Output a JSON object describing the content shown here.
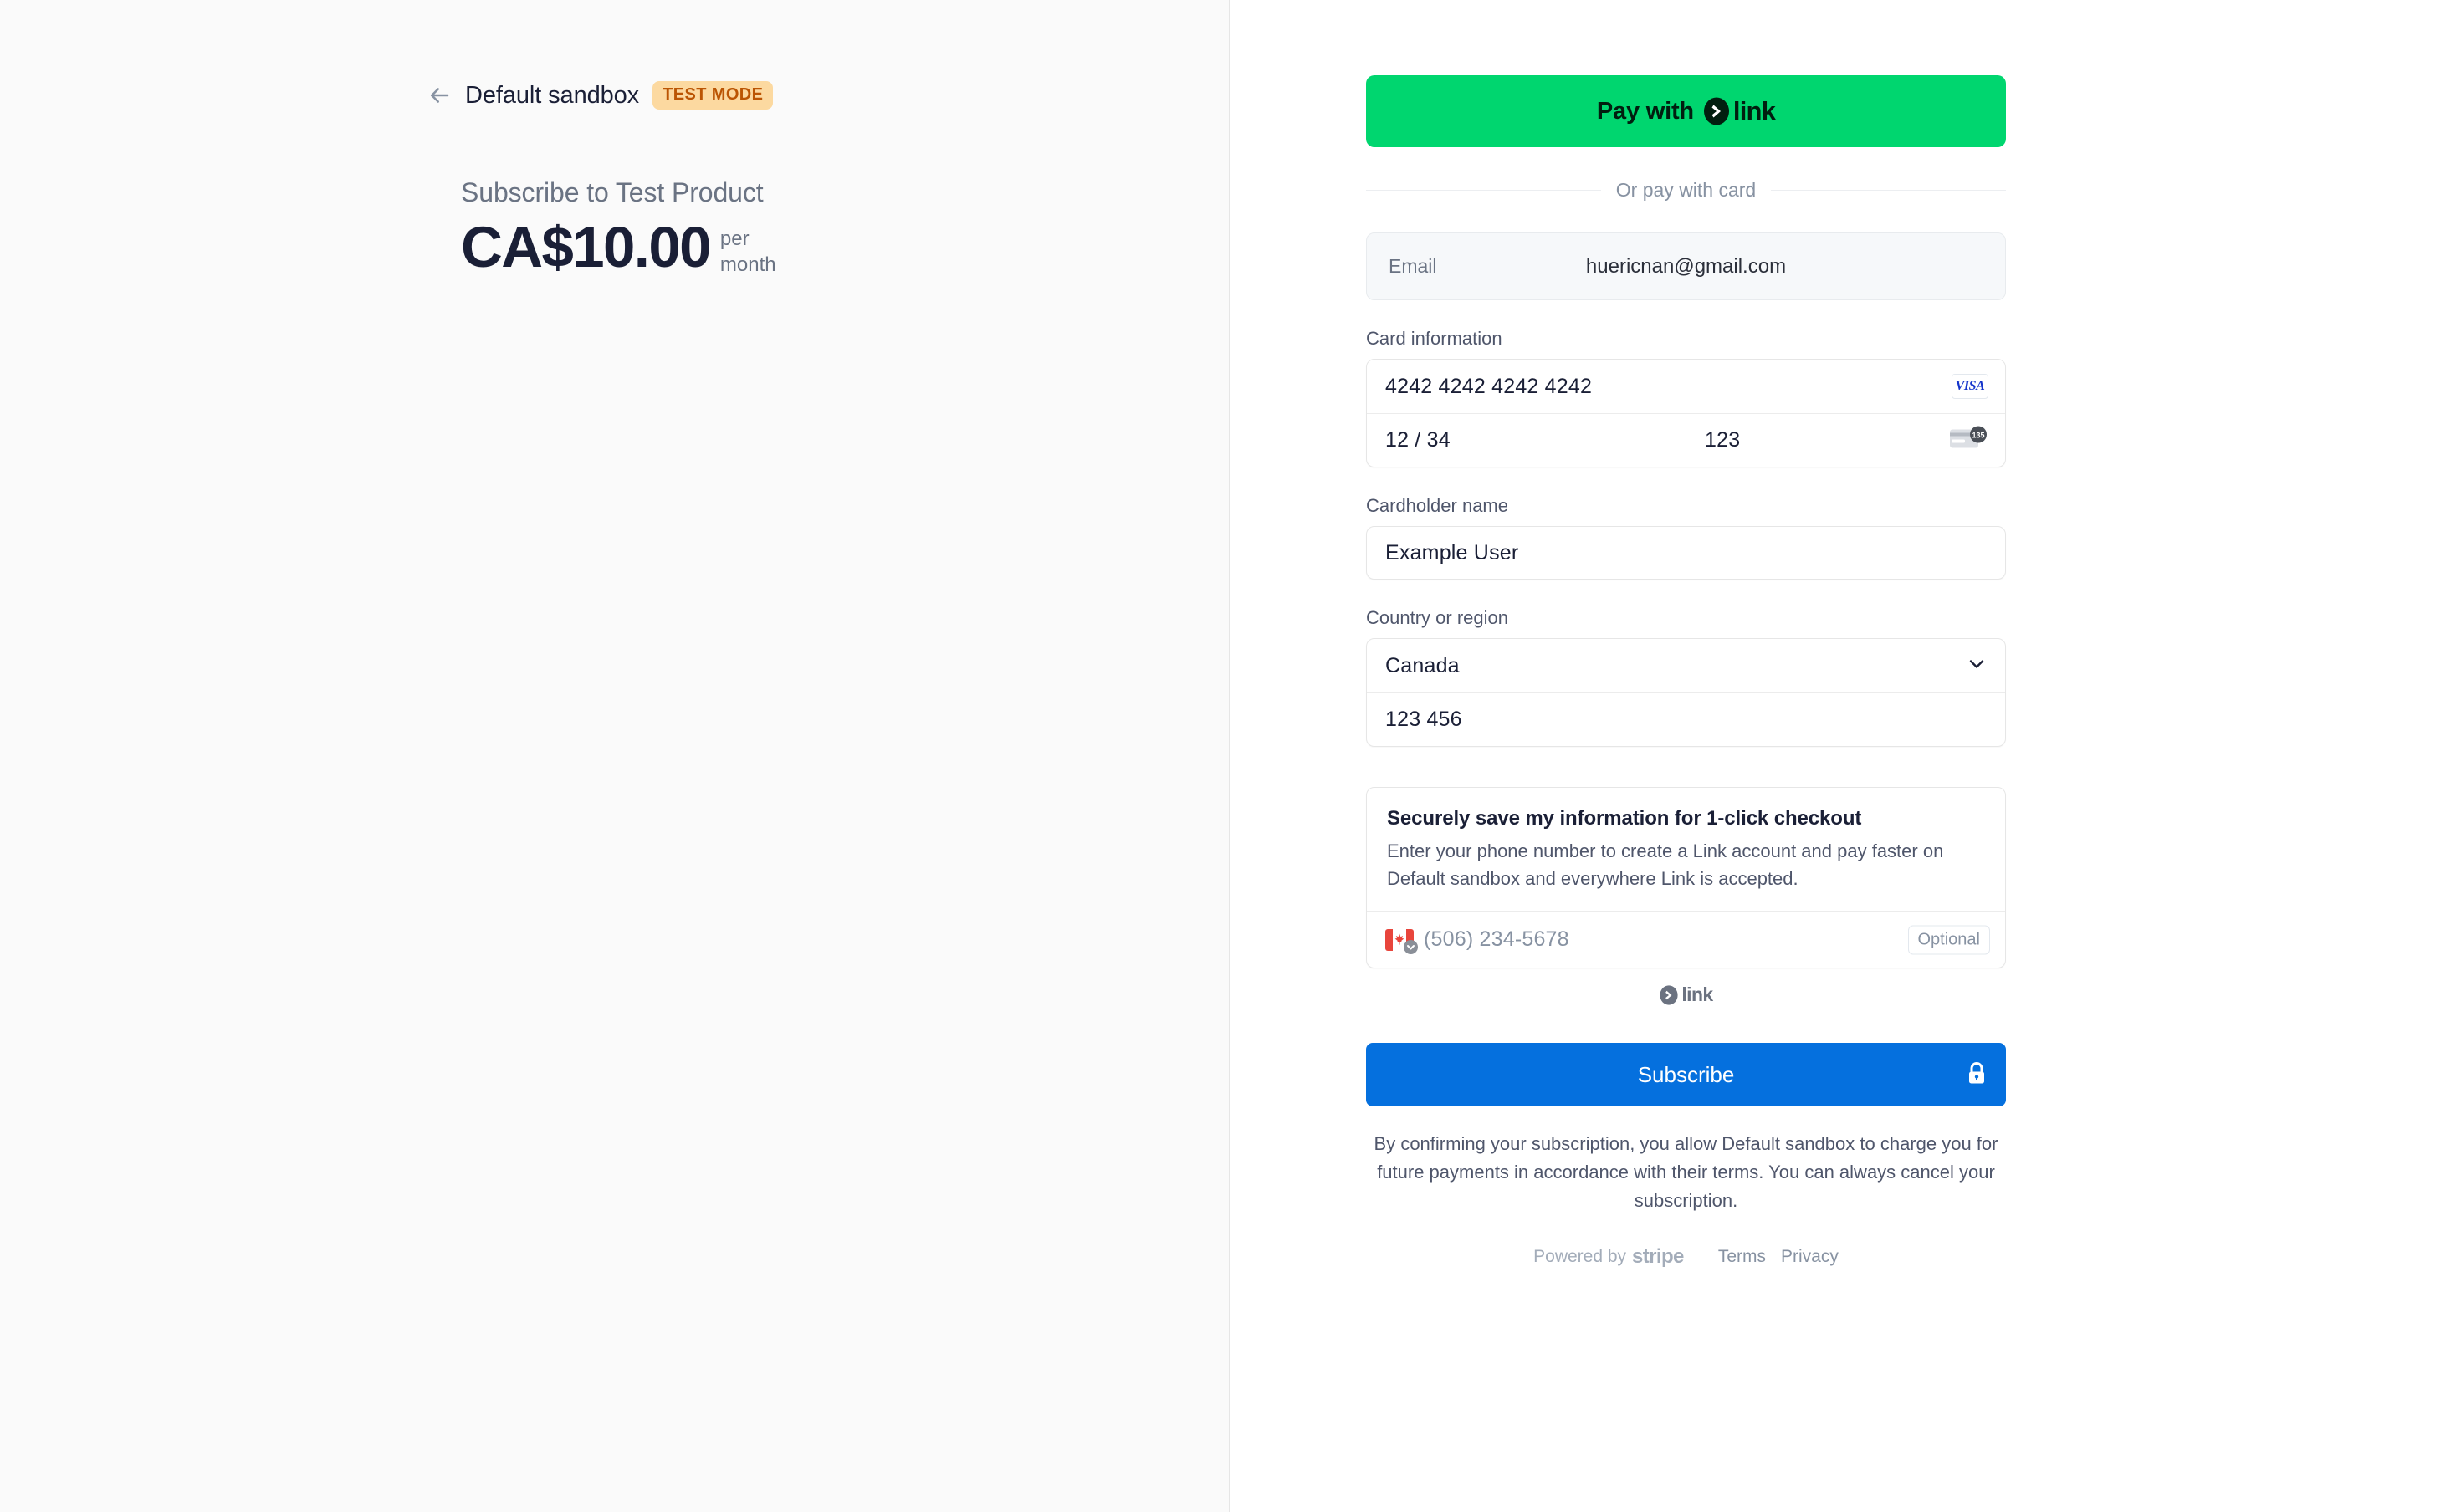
{
  "merchant": {
    "back_icon": "arrow-left-icon",
    "name": "Default sandbox",
    "mode_badge": "TEST MODE"
  },
  "product": {
    "title": "Subscribe to Test Product",
    "amount": "CA$10.00",
    "interval_line1": "per",
    "interval_line2": "month"
  },
  "payment": {
    "link_button_text": "Pay with",
    "link_wordmark": "link",
    "divider_text": "Or pay with card",
    "email": {
      "label": "Email",
      "value": "huericnan@gmail.com"
    },
    "card": {
      "label": "Card information",
      "number": "4242 4242 4242 4242",
      "brand_badge": "VISA",
      "expiry": "12 / 34",
      "cvc": "123",
      "cvc_icon_digits": "135"
    },
    "cardholder": {
      "label": "Cardholder name",
      "value": "Example User"
    },
    "country": {
      "label": "Country or region",
      "value": "Canada",
      "postal": "123 456",
      "chevron_icon": "chevron-down-icon"
    },
    "save_info": {
      "title": "Securely save my information for 1-click checkout",
      "description": "Enter your phone number to create a Link account and pay faster on Default sandbox and everywhere Link is accepted.",
      "phone_placeholder": "(506) 234-5678",
      "phone_flag": "canada-flag-icon",
      "optional_badge": "Optional",
      "link_wordmark": "link"
    },
    "submit": {
      "label": "Subscribe",
      "lock_icon": "lock-icon"
    },
    "terms_note": "By confirming your subscription, you allow Default sandbox to charge you for future payments in accordance with their terms. You can always cancel your subscription."
  },
  "footer": {
    "powered_by": "Powered by",
    "stripe": "stripe",
    "terms": "Terms",
    "privacy": "Privacy"
  },
  "colors": {
    "link_green": "#00d66f",
    "stripe_blue": "#0570de",
    "test_badge_bg": "#fcd9a0",
    "test_badge_text": "#bb5504",
    "visa_blue": "#1434cb"
  }
}
